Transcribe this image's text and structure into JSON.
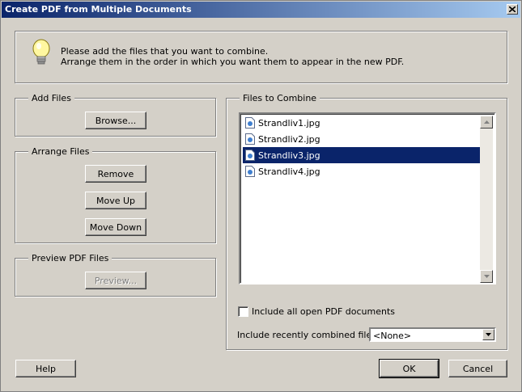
{
  "window": {
    "title": "Create PDF from Multiple Documents"
  },
  "info": {
    "line1": "Please add the files that you want to combine.",
    "line2": "Arrange them in the order in which you want them to appear in the new PDF.",
    "icon": "lightbulb-icon"
  },
  "add_files": {
    "label": "Add Files",
    "browse": "Browse..."
  },
  "arrange_files": {
    "label": "Arrange Files",
    "remove": "Remove",
    "move_up": "Move Up",
    "move_down": "Move Down"
  },
  "preview": {
    "label": "Preview PDF Files",
    "preview_button": "Preview..."
  },
  "files_to_combine": {
    "label": "Files to Combine",
    "files": [
      {
        "name": "Strandliv1.jpg",
        "selected": false
      },
      {
        "name": "Strandliv2.jpg",
        "selected": false
      },
      {
        "name": "Strandliv3.jpg",
        "selected": true
      },
      {
        "name": "Strandliv4.jpg",
        "selected": false
      }
    ],
    "include_open_label": "Include all open PDF documents",
    "include_open_checked": false,
    "recent_label": "Include recently combined files:",
    "recent_value": "<None>"
  },
  "footer": {
    "help": "Help",
    "ok": "OK",
    "cancel": "Cancel"
  },
  "colors": {
    "title_start": "#0a246a",
    "title_end": "#a6caf0",
    "selection": "#0a246a",
    "face": "#d4d0c8"
  }
}
